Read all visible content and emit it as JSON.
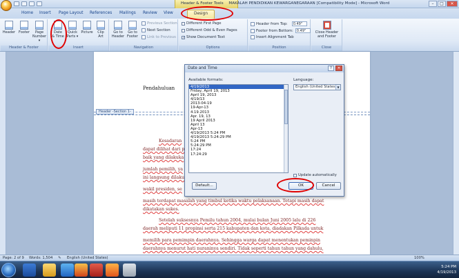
{
  "window": {
    "title": "MAKALAH PENDIDIKAN KEWARGANEGARAAN [Compatibility Mode] - Microsoft Word",
    "context_tool": "Header & Footer Tools",
    "controls": {
      "minimize": "–",
      "maximize": "□",
      "close": "✕"
    }
  },
  "tabs": [
    "Home",
    "Insert",
    "Page Layout",
    "References",
    "Mailings",
    "Review",
    "View",
    "Design"
  ],
  "active_tab": "Design",
  "ribbon": {
    "hf_group": {
      "label": "Header & Footer",
      "header": "Header",
      "footer": "Footer",
      "page_number_line1": "Page",
      "page_number_line2": "Number ▾"
    },
    "insert_group": {
      "label": "Insert",
      "date_time_line1": "Date",
      "date_time_line2": "& Time",
      "quick_parts_line1": "Quick",
      "quick_parts_line2": "Parts ▾",
      "picture": "Picture",
      "clip_art_line1": "Clip",
      "clip_art_line2": "Art"
    },
    "navigation_group": {
      "label": "Navigation",
      "goto_header_line1": "Go to",
      "goto_header_line2": "Header",
      "goto_footer_line1": "Go to",
      "goto_footer_line2": "Footer",
      "previous_section": "Previous Section",
      "next_section": "Next Section",
      "link_to_previous": "Link to Previous"
    },
    "options_group": {
      "label": "Options",
      "different_first_page": "Different First Page",
      "different_odd_even": "Different Odd & Even Pages",
      "show_document_text": "Show Document Text",
      "show_document_text_checked": true
    },
    "position_group": {
      "label": "Position",
      "header_from_top_label": "Header from Top:",
      "header_from_top_value": "0.49\"",
      "footer_from_bottom_label": "Footer from Bottom:",
      "footer_from_bottom_value": "0.49\"",
      "insert_alignment_tab": "Insert Alignment Tab"
    },
    "close_group": {
      "label": "Close",
      "close_line1": "Close Header",
      "close_line2": "and Footer"
    }
  },
  "document": {
    "heading": "Pendahuluan",
    "header_tag": "Header -Section 1-",
    "lines": [
      "Kesadaran",
      "dapat dilihat dari p",
      "baik yang dilakuka",
      "jumlah pemilih, ya",
      "ini langsung dilaku",
      "wakil presiden,  se",
      "masih terdapat  masalah yang timbul ketika  waktu pelaksanaan. Tetapi masih  dapat",
      "dikatakan sukes.",
      "Setelah  suksesnya  Pemilu  tahun  2004,  mulai  bulan  Juni  2005  lalu  di  226",
      "daerah  meliputi  11  propinsi  serta  215  kabupaten  dan  kota,  diadakan  Pilkada  untuk",
      "memilih  para  pemimpin  daerahnya.  Sehingga  warga  dapat  menentukan  peminpin",
      "daerahnya  menurut  hati  nuraninya  sendiri.  Tidak  seperti  tahun  tahun  yang  dahulu,"
    ]
  },
  "dialog": {
    "title": "Date and Time",
    "help": "?",
    "close": "✕",
    "available_formats_label": "Available formats:",
    "formats": [
      "4/19/2013",
      "Friday, April 19, 2013",
      "April 19, 2013",
      "4/19/13",
      "2013-04-19",
      "19-Apr-13",
      "4.19.2013",
      "Apr. 19, 13",
      "19 April 2013",
      "April 13",
      "Apr-13",
      "4/19/2013 5:24 PM",
      "4/19/2013 5:24:29 PM",
      "5:24 PM",
      "5:24:29 PM",
      "17:24",
      "17:24:29"
    ],
    "selected_index": 0,
    "language_label": "Language:",
    "language_value": "English (United States)",
    "update_automatically": "Update automatically",
    "update_checked": false,
    "default_button": "Default...",
    "ok_button": "OK",
    "cancel_button": "Cancel"
  },
  "statusbar": {
    "page": "Page: 2 of 9",
    "words": "Words: 1,504",
    "language": "English (United States)",
    "zoom": "100%"
  },
  "taskbar": {
    "time": "5:24 PM",
    "date": "4/19/2013"
  },
  "colors": {
    "annotation_ring": "#e00000",
    "ribbon_bg": "#dfe9f6",
    "selection": "#3166c4",
    "taskbar": "#1c3354"
  }
}
